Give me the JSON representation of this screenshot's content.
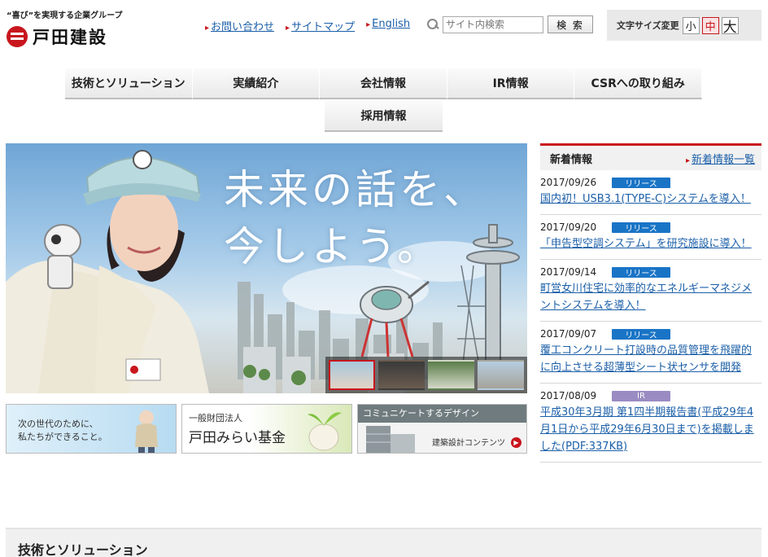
{
  "header": {
    "tagline": "“喜び”を実現する企業グループ",
    "brand_name": "戸田建設",
    "links": [
      {
        "label": "お問い合わせ"
      },
      {
        "label": "サイトマップ"
      },
      {
        "label": "English"
      }
    ],
    "search": {
      "placeholder": "サイト内検索",
      "button_label": "検 索"
    },
    "font_size": {
      "label": "文字サイズ変更",
      "small": "小",
      "medium": "中",
      "large": "大",
      "selected": "中"
    }
  },
  "nav": {
    "items": [
      {
        "label": "技術とソリューション"
      },
      {
        "label": "実績紹介"
      },
      {
        "label": "会社情報"
      },
      {
        "label": "IR情報"
      },
      {
        "label": "CSRへの取り組み"
      }
    ],
    "second_row": {
      "label": "採用情報"
    }
  },
  "hero": {
    "line1": "未来の話を、",
    "line2": "今しよう。",
    "thumbnails": 4,
    "active_thumbnail": 1
  },
  "banners": {
    "b1_line1": "次の世代のために、",
    "b1_line2": "私たちができること。",
    "b2_small": "一般財団法人",
    "b2_big": "戸田みらい基金",
    "b3_top": "コミュニケートするデザイン",
    "b3_bottom": "建築設計コンテンツ"
  },
  "news": {
    "title": "新着情報",
    "list_link": "新着情報一覧",
    "entries": [
      {
        "date": "2017/09/26",
        "badge": "リリース",
        "text": "国内初！USB3.1(TYPE-C)システムを導入！"
      },
      {
        "date": "2017/09/20",
        "badge": "リリース",
        "text": "「申告型空調システム」を研究施設に導入！"
      },
      {
        "date": "2017/09/14",
        "badge": "リリース",
        "text": "町営女川住宅に効率的なエネルギーマネジメントシステムを導入！"
      },
      {
        "date": "2017/09/07",
        "badge": "リリース",
        "text": "覆工コンクリート打設時の品質管理を飛躍的に向上させる超薄型シート状センサを開発"
      },
      {
        "date": "2017/08/09",
        "badge": "IR",
        "text": "平成30年3月期 第1四半期報告書(平成29年4月1日から平成29年6月30日まで)を掲載しました(PDF:337KB)"
      }
    ]
  },
  "section": {
    "title": "技術とソリューション"
  },
  "colors": {
    "brand_red": "#c8161d",
    "link_blue": "#1b5fa8",
    "release_badge": "#1a74c6",
    "ir_badge": "#9a8cc2"
  }
}
